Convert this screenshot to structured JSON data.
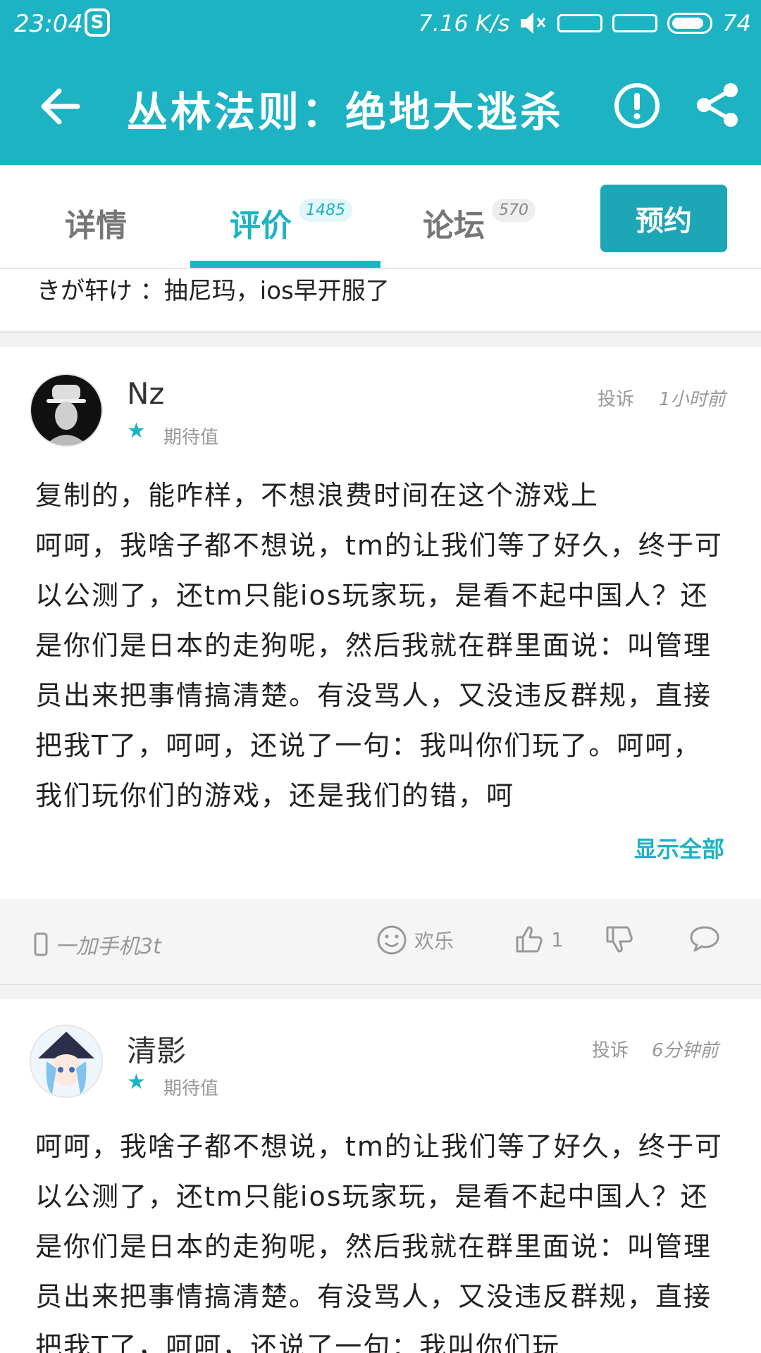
{
  "status_bar": {
    "time": "23:04",
    "app_icon": "S",
    "speed": "7.16 K/s",
    "signal_1": "SIG",
    "signal_2": "4G",
    "battery": "74"
  },
  "app_bar": {
    "title": "丛林法则：绝地大逃杀"
  },
  "tabs": [
    {
      "label": "详情"
    },
    {
      "label": "评价",
      "count": "1485"
    },
    {
      "label": "论坛",
      "count": "570"
    }
  ],
  "reserve_label": "预约",
  "prev_reply": "きが轩け ：抽尼玛，ios早开服了",
  "reviews": [
    {
      "username": "Nz",
      "report": "投诉",
      "time": "1小时前",
      "tag": "期待值",
      "text": "复制的，能咋样，不想浪费时间在这个游戏上\n呵呵，我啥子都不想说，tm的让我们等了好久，终于可以公测了，还tm只能ios玩家玩，是看不起中国人？还是你们是日本的走狗呢，然后我就在群里面说：叫管理员出来把事情搞清楚。有没骂人，又没违反群规，直接把我T了，呵呵，还说了一句：我叫你们玩了。呵呵，我们玩你们的游戏，还是我们的错，呵",
      "show_all": "显示全部",
      "device": "一加手机3t",
      "emotion": "欢乐",
      "likes": "1"
    },
    {
      "username": "清影",
      "report": "投诉",
      "time": "6分钟前",
      "tag": "期待值",
      "text": "呵呵，我啥子都不想说，tm的让我们等了好久，终于可以公测了，还tm只能ios玩家玩，是看不起中国人？还是你们是日本的走狗呢，然后我就在群里面说：叫管理员出来把事情搞清楚。有没骂人，又没违反群规，直接把我T了，呵呵，还说了一句：我叫你们玩"
    }
  ]
}
